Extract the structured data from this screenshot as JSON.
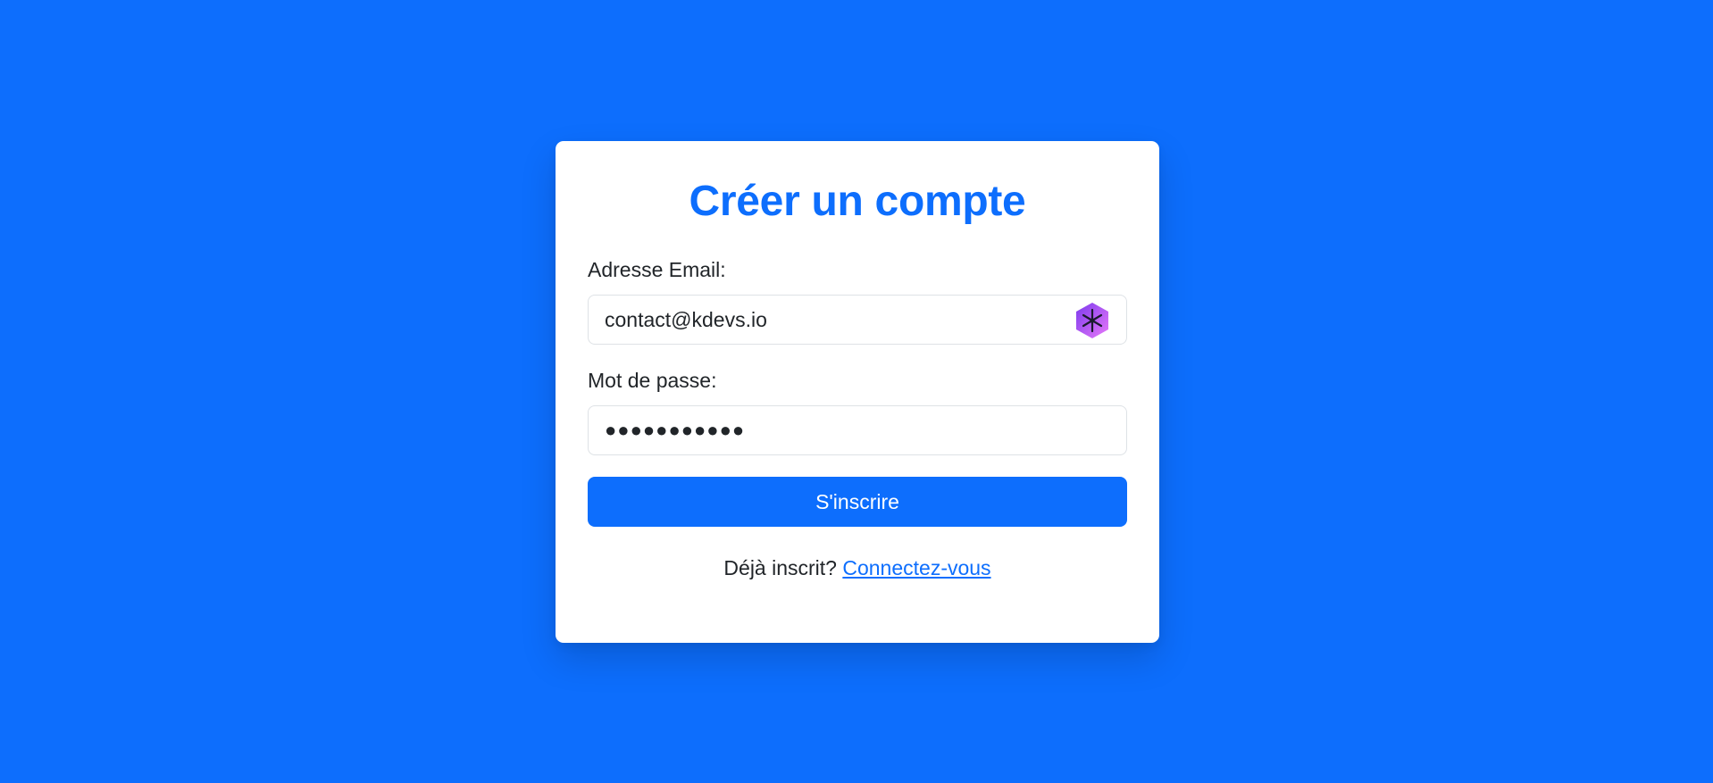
{
  "form": {
    "title": "Créer un compte",
    "email_label": "Adresse Email:",
    "email_value": "contact@kdevs.io",
    "password_label": "Mot de passe:",
    "password_mask": "●●●●●●●●●●●",
    "submit_label": "S'inscrire",
    "login_prompt": "Déjà inscrit?",
    "login_link": "Connectez-vous"
  },
  "colors": {
    "background": "#0d6efd",
    "accent": "#0d6efd",
    "card": "#ffffff",
    "text": "#212529",
    "extension_icon": "#a855f7"
  },
  "icons": {
    "email_field_extension": "password-manager-icon"
  }
}
